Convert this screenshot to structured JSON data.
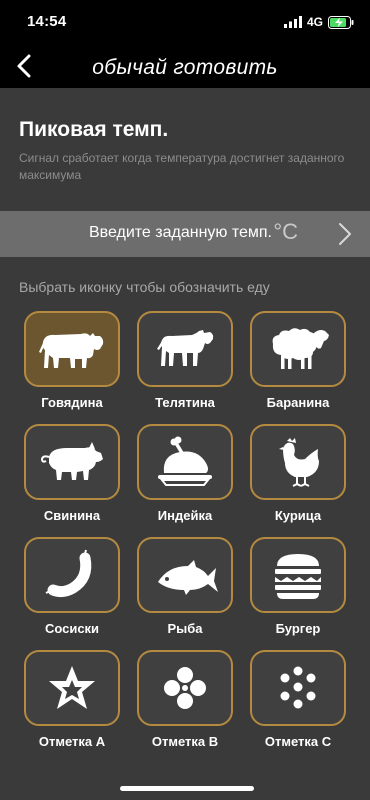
{
  "status": {
    "time": "14:54",
    "network": "4G"
  },
  "nav": {
    "title": "обычай готовить"
  },
  "header": {
    "title": "Пиковая темп.",
    "description": "Сигнал сработает когда температура достигнет заданного максимума"
  },
  "temp_input": {
    "label": "Введите заданную темп.",
    "unit": "°C"
  },
  "picker": {
    "prompt": "Выбрать иконку чтобы обозначить еду",
    "items": [
      {
        "label": "Говядина",
        "icon": "beef-icon",
        "selected": true
      },
      {
        "label": "Телятина",
        "icon": "calf-icon",
        "selected": false
      },
      {
        "label": "Баранина",
        "icon": "lamb-icon",
        "selected": false
      },
      {
        "label": "Свинина",
        "icon": "pork-icon",
        "selected": false
      },
      {
        "label": "Индейка",
        "icon": "turkey-icon",
        "selected": false
      },
      {
        "label": "Курица",
        "icon": "chicken-icon",
        "selected": false
      },
      {
        "label": "Сосиски",
        "icon": "sausage-icon",
        "selected": false
      },
      {
        "label": "Рыба",
        "icon": "fish-icon",
        "selected": false
      },
      {
        "label": "Бургер",
        "icon": "burger-icon",
        "selected": false
      },
      {
        "label": "Отметка А",
        "icon": "star-icon",
        "selected": false
      },
      {
        "label": "Отметка В",
        "icon": "flower-icon",
        "selected": false
      },
      {
        "label": "Отметка С",
        "icon": "dots-ring-icon",
        "selected": false
      }
    ]
  },
  "colors": {
    "accent": "#b48a40",
    "selected_tile": "#6b5630",
    "tile": "#404040",
    "background": "#3a3a3a",
    "temp_bar": "#6d6d6d"
  }
}
